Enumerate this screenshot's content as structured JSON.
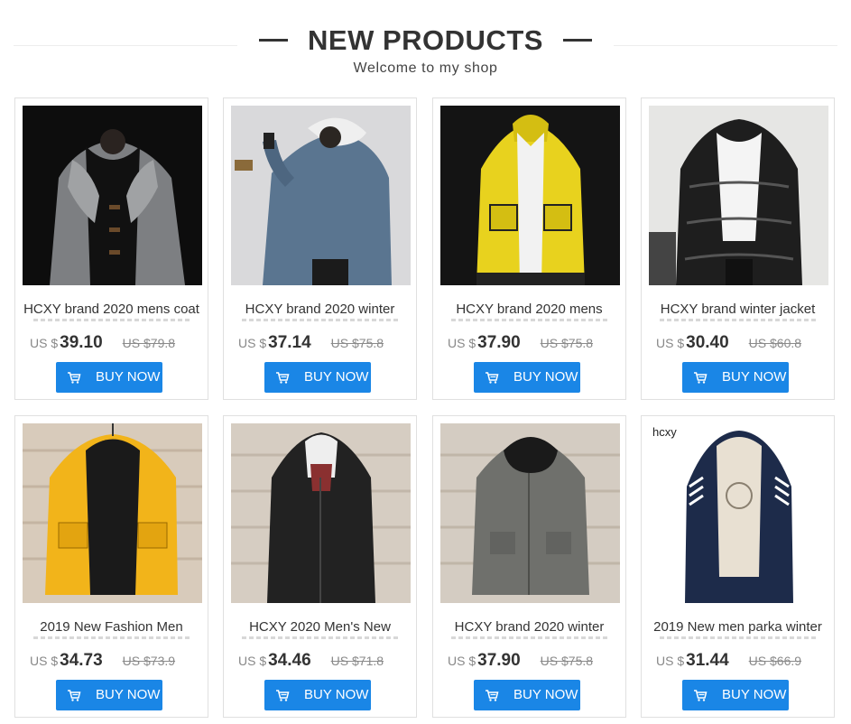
{
  "header": {
    "title": "NEW PRODUCTS",
    "subtitle": "Welcome to my shop"
  },
  "products": [
    {
      "name": "HCXY brand 2020 mens coat",
      "currency": "US $",
      "price": "39.10",
      "old_price": "US $79.8",
      "button": "BUY NOW",
      "image": "grey-fleece-jacket",
      "accent": "#7d7f82"
    },
    {
      "name": "HCXY brand 2020 winter",
      "currency": "US $",
      "price": "37.14",
      "old_price": "US $75.8",
      "button": "BUY NOW",
      "image": "blue-hooded-parka",
      "accent": "#5a7590"
    },
    {
      "name": "HCXY brand 2020 mens",
      "currency": "US $",
      "price": "37.90",
      "old_price": "US $75.8",
      "button": "BUY NOW",
      "image": "yellow-hooded-parka",
      "accent": "#e8d21e"
    },
    {
      "name": "HCXY brand winter jacket",
      "currency": "US $",
      "price": "30.40",
      "old_price": "US $60.8",
      "button": "BUY NOW",
      "image": "black-puffer-jacket",
      "accent": "#1e1e1e"
    },
    {
      "name": "2019 New Fashion Men",
      "currency": "US $",
      "price": "34.73",
      "old_price": "US $73.9",
      "button": "BUY NOW",
      "image": "yellow-hooded-jacket",
      "accent": "#f2b41a"
    },
    {
      "name": "HCXY 2020 Men's New",
      "currency": "US $",
      "price": "34.46",
      "old_price": "US $71.8",
      "button": "BUY NOW",
      "image": "black-long-parka",
      "accent": "#222222"
    },
    {
      "name": "HCXY brand 2020 winter",
      "currency": "US $",
      "price": "37.90",
      "old_price": "US $75.8",
      "button": "BUY NOW",
      "image": "grey-fur-hood-parka",
      "accent": "#6f706c"
    },
    {
      "name": "2019 New men parka winter",
      "currency": "US $",
      "price": "31.44",
      "old_price": "US $66.9",
      "button": "BUY NOW",
      "image": "navy-padded-jacket",
      "accent": "#1d2b4a",
      "logo_text": "hcxy"
    }
  ],
  "colors": {
    "button": "#1a86e6",
    "border": "#e0e0e0"
  },
  "icons": {
    "button": "cart-icon"
  }
}
